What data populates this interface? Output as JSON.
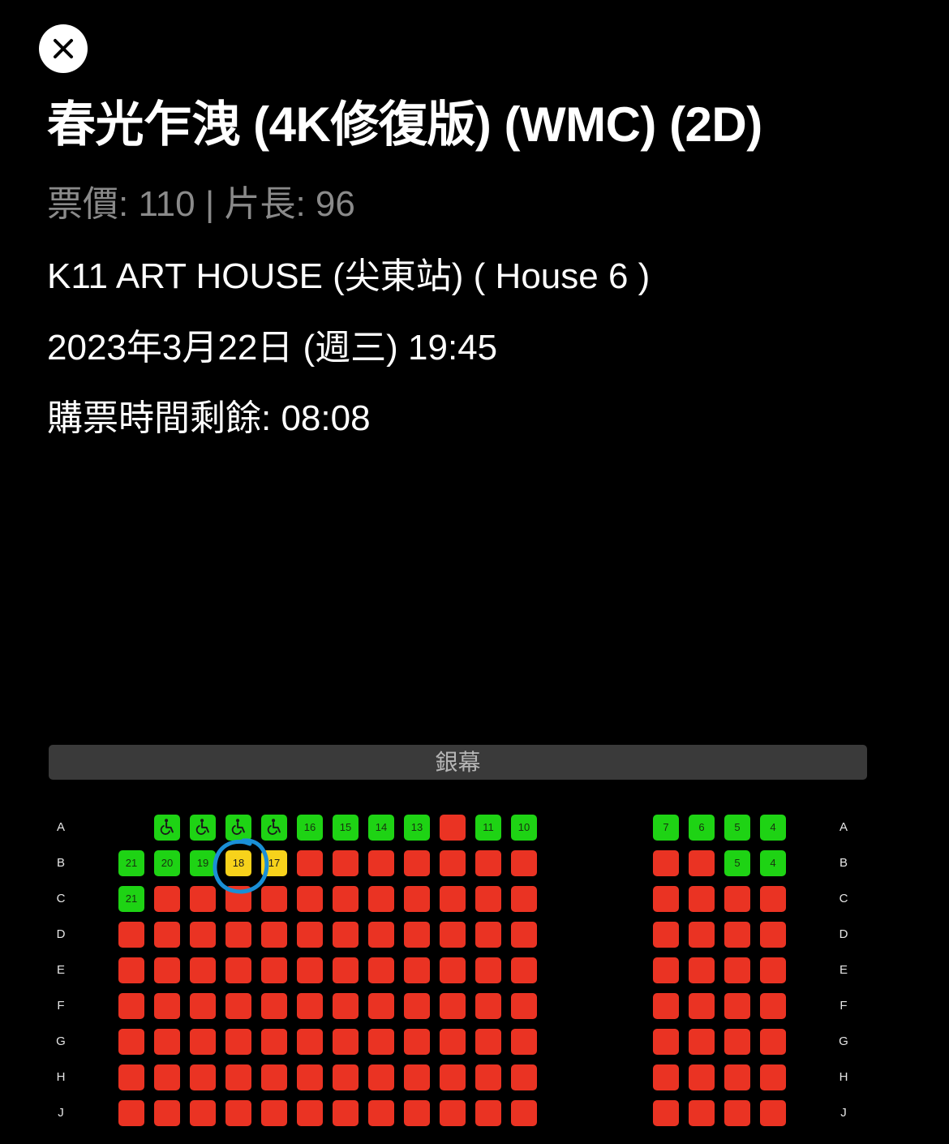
{
  "header": {
    "close_icon": "close-icon",
    "title": "春光乍洩 (4K修復版) (WMC) (2D)",
    "price_duration": "票價: 110 | 片長: 96",
    "venue": "K11 ART HOUSE (尖東站) ( House 6 )",
    "datetime": "2023年3月22日 (週三) 19:45",
    "timer": "購票時間剩餘: 08:08"
  },
  "seatmap": {
    "screen_label": "銀幕",
    "colors": {
      "sold": "#ea3323",
      "available": "#1ed314",
      "selected": "#f7d21b",
      "annotation": "#1a8fd6"
    },
    "rows": [
      {
        "label": "A",
        "seats": [
          null,
          {
            "status": "available",
            "icon": "wheelchair-icon"
          },
          {
            "status": "available",
            "icon": "wheelchair-icon"
          },
          {
            "status": "available",
            "icon": "wheelchair-icon"
          },
          {
            "status": "available",
            "icon": "wheelchair-icon"
          },
          {
            "status": "available",
            "num": "16"
          },
          {
            "status": "available",
            "num": "15"
          },
          {
            "status": "available",
            "num": "14"
          },
          {
            "status": "available",
            "num": "13"
          },
          {
            "status": "sold"
          },
          {
            "status": "available",
            "num": "11"
          },
          {
            "status": "available",
            "num": "10"
          },
          {
            "status": "available",
            "num": "7"
          },
          {
            "status": "available",
            "num": "6"
          },
          {
            "status": "available",
            "num": "5"
          },
          {
            "status": "available",
            "num": "4"
          }
        ]
      },
      {
        "label": "B",
        "seats": [
          {
            "status": "available",
            "num": "21"
          },
          {
            "status": "available",
            "num": "20"
          },
          {
            "status": "available",
            "num": "19"
          },
          {
            "status": "selected",
            "num": "18"
          },
          {
            "status": "selected",
            "num": "17"
          },
          {
            "status": "sold"
          },
          {
            "status": "sold"
          },
          {
            "status": "sold"
          },
          {
            "status": "sold"
          },
          {
            "status": "sold"
          },
          {
            "status": "sold"
          },
          {
            "status": "sold"
          },
          {
            "status": "sold"
          },
          {
            "status": "sold"
          },
          {
            "status": "available",
            "num": "5"
          },
          {
            "status": "available",
            "num": "4"
          }
        ]
      },
      {
        "label": "C",
        "seats": [
          {
            "status": "available",
            "num": "21"
          },
          {
            "status": "sold"
          },
          {
            "status": "sold"
          },
          {
            "status": "sold"
          },
          {
            "status": "sold"
          },
          {
            "status": "sold"
          },
          {
            "status": "sold"
          },
          {
            "status": "sold"
          },
          {
            "status": "sold"
          },
          {
            "status": "sold"
          },
          {
            "status": "sold"
          },
          {
            "status": "sold"
          },
          {
            "status": "sold"
          },
          {
            "status": "sold"
          },
          {
            "status": "sold"
          },
          {
            "status": "sold"
          }
        ]
      },
      {
        "label": "D",
        "all": "sold"
      },
      {
        "label": "E",
        "all": "sold"
      },
      {
        "label": "F",
        "all": "sold"
      },
      {
        "label": "G",
        "all": "sold"
      },
      {
        "label": "H",
        "all": "sold"
      },
      {
        "label": "J",
        "all": "sold"
      }
    ],
    "annotation": "circle around seat B18"
  }
}
